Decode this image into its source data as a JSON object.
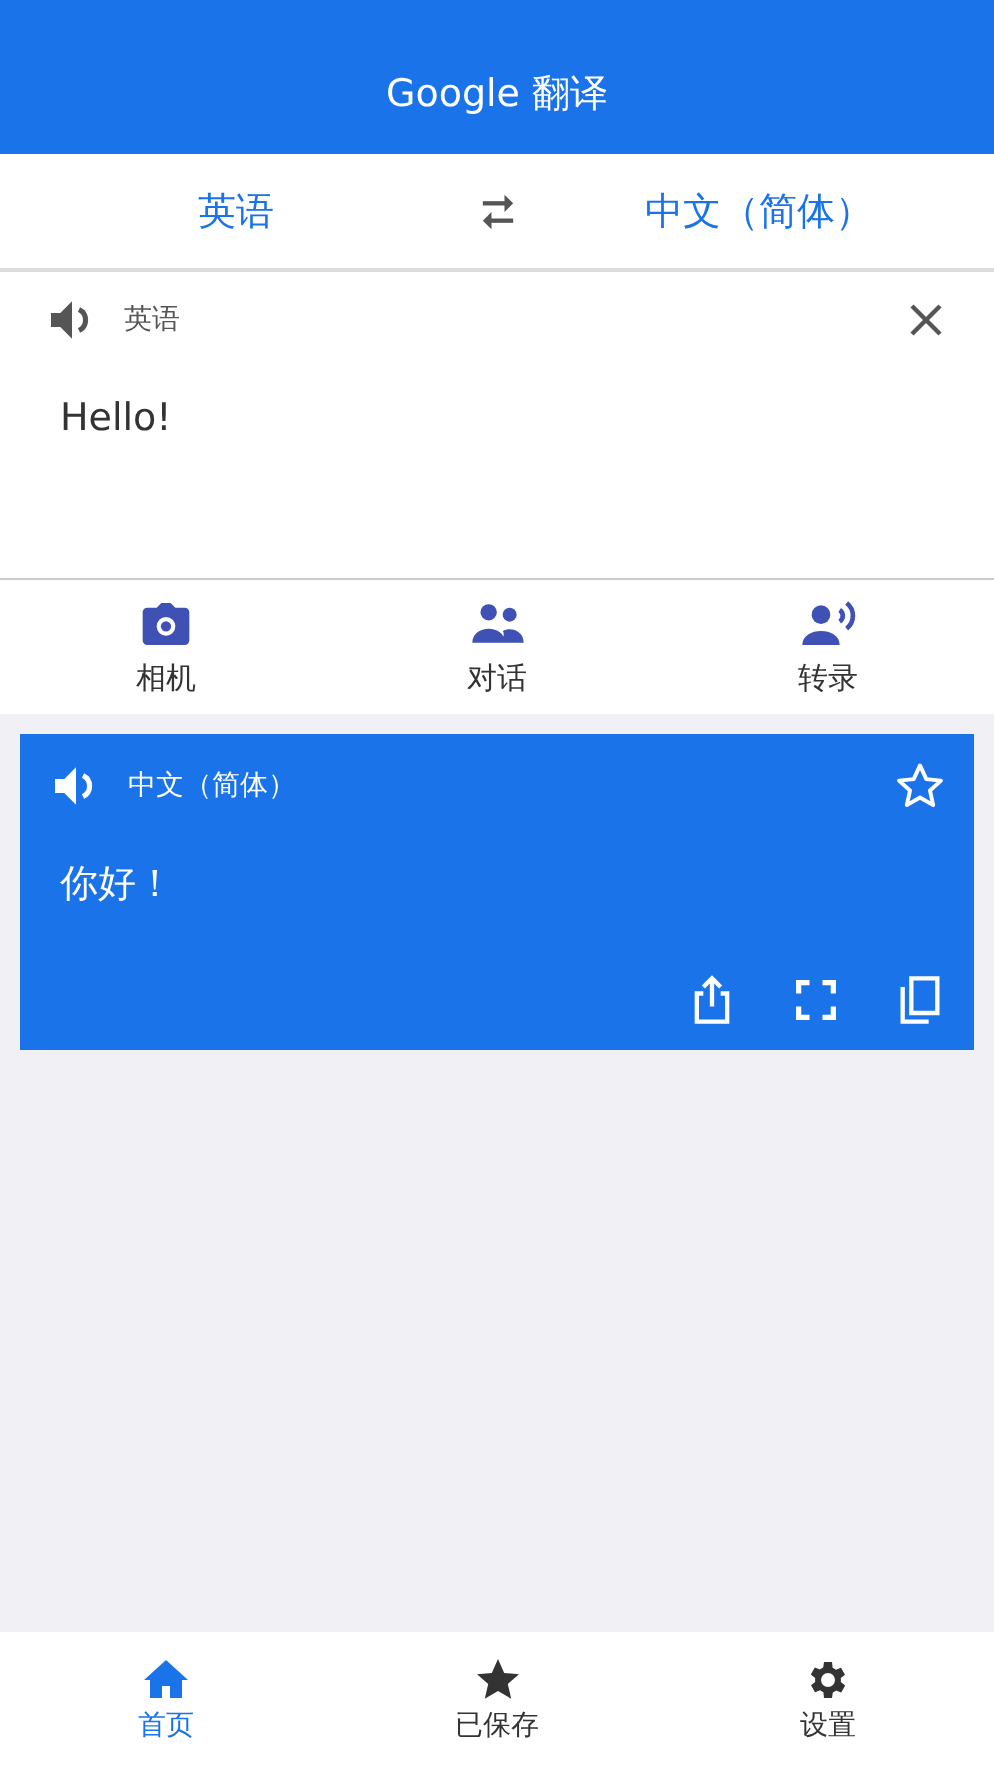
{
  "header": {
    "title": "Google 翻译"
  },
  "languages": {
    "source": "英语",
    "target": "中文（简体）"
  },
  "input": {
    "language": "英语",
    "text": "Hello!"
  },
  "modes": [
    {
      "kind": "camera",
      "label": "相机"
    },
    {
      "kind": "conversation",
      "label": "对话"
    },
    {
      "kind": "transcribe",
      "label": "转录"
    }
  ],
  "result": {
    "language": "中文（简体）",
    "text": "你好！",
    "starred": false
  },
  "nav": [
    {
      "kind": "home",
      "label": "首页",
      "selected": true
    },
    {
      "kind": "saved",
      "label": "已保存",
      "selected": false
    },
    {
      "kind": "settings",
      "label": "设置",
      "selected": false
    }
  ]
}
